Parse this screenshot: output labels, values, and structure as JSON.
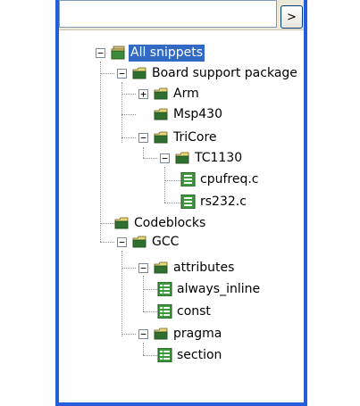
{
  "search": {
    "placeholder": "",
    "value": "",
    "go_label": ">"
  },
  "tree": {
    "nodes": [
      {
        "label": "All snippets",
        "icon": "folder-stack-icon",
        "expander": "minus",
        "selected": true
      },
      {
        "label": "Board support package",
        "icon": "folder-icon",
        "expander": "minus"
      },
      {
        "label": "Arm",
        "icon": "folder-icon",
        "expander": "plus"
      },
      {
        "label": "Msp430",
        "icon": "folder-icon"
      },
      {
        "label": "TriCore",
        "icon": "folder-icon",
        "expander": "minus"
      },
      {
        "label": "TC1130",
        "icon": "folder-icon",
        "expander": "minus"
      },
      {
        "label": "cpufreq.c",
        "icon": "source-file-icon"
      },
      {
        "label": "rs232.c",
        "icon": "source-file-icon"
      },
      {
        "label": "Codeblocks",
        "icon": "folder-icon"
      },
      {
        "label": "GCC",
        "icon": "folder-icon",
        "expander": "minus"
      },
      {
        "label": "attributes",
        "icon": "folder-icon",
        "expander": "minus"
      },
      {
        "label": "always_inline",
        "icon": "snippet-icon"
      },
      {
        "label": "const",
        "icon": "snippet-icon"
      },
      {
        "label": "pragma",
        "icon": "folder-icon",
        "expander": "minus"
      },
      {
        "label": "section",
        "icon": "snippet-icon"
      }
    ]
  },
  "colors": {
    "selection": "#316ac5",
    "frame": "#245edc",
    "folder": "#e7d77a",
    "file": "#3c9a3c"
  }
}
